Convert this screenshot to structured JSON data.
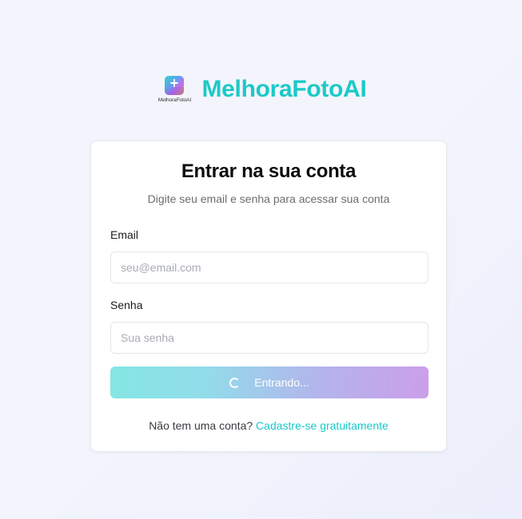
{
  "brand": {
    "name": "MelhoraFotoAI",
    "logo_caption": "MelhoraFotoAI",
    "logo_icon": "sparkle-photo-icon"
  },
  "card": {
    "title": "Entrar na sua conta",
    "subtitle": "Digite seu email e senha para acessar sua conta"
  },
  "form": {
    "email_label": "Email",
    "email_value": "",
    "email_placeholder": "seu@email.com",
    "password_label": "Senha",
    "password_value": "",
    "password_placeholder": "Sua senha",
    "submit_label": "Entrando...",
    "submit_state": "loading",
    "spinner_icon": "spinner-icon"
  },
  "signup": {
    "prompt": "Não tem uma conta?",
    "link_label": "Cadastre-se gratuitamente"
  },
  "colors": {
    "accent": "#1cc9c8",
    "button_gradient_start": "#84e6e3",
    "button_gradient_end": "#cc9ee9"
  }
}
